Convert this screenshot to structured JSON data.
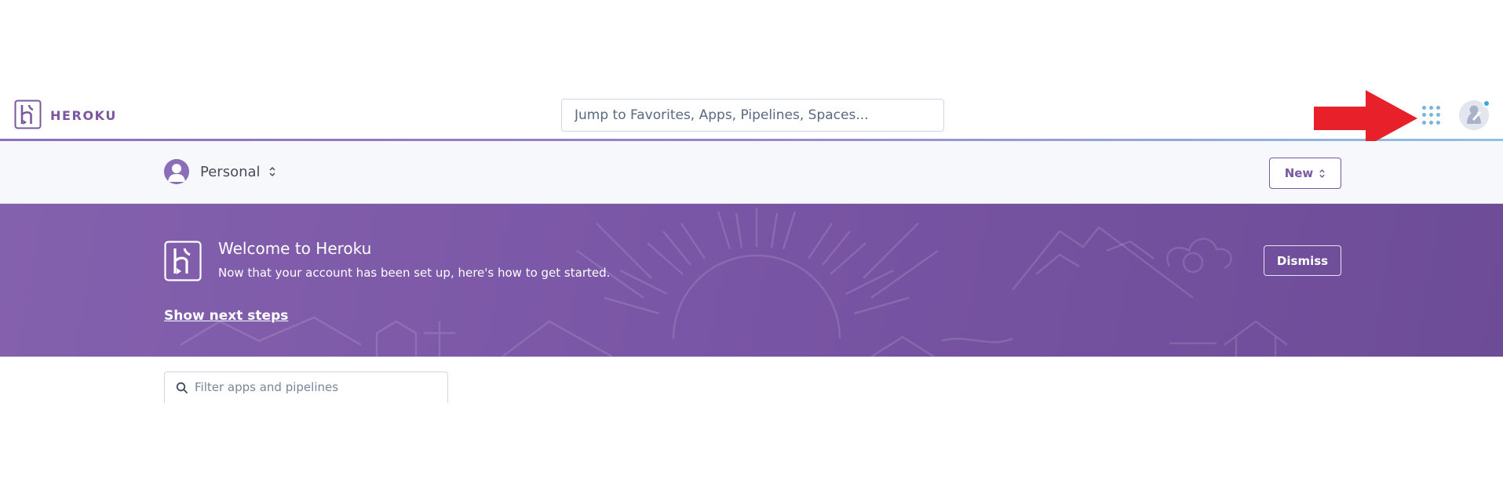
{
  "header": {
    "brand": "HEROKU",
    "search_placeholder": "Jump to Favorites, Apps, Pipelines, Spaces...",
    "apps_icon": "apps-grid-icon",
    "avatar_icon": "user-avatar-icon",
    "annotation_icon": "red-arrow-icon"
  },
  "subheader": {
    "account_label": "Personal",
    "new_button_label": "New"
  },
  "banner": {
    "title": "Welcome to Heroku",
    "subtitle": "Now that your account has been set up, here's how to get started.",
    "link_label": "Show next steps",
    "dismiss_label": "Dismiss"
  },
  "filter": {
    "placeholder": "Filter apps and pipelines"
  },
  "colors": {
    "brand_purple": "#79589f",
    "banner_purple": "#7a56a6",
    "accent_blue": "#79b4dc",
    "arrow_red": "#e8202a"
  }
}
